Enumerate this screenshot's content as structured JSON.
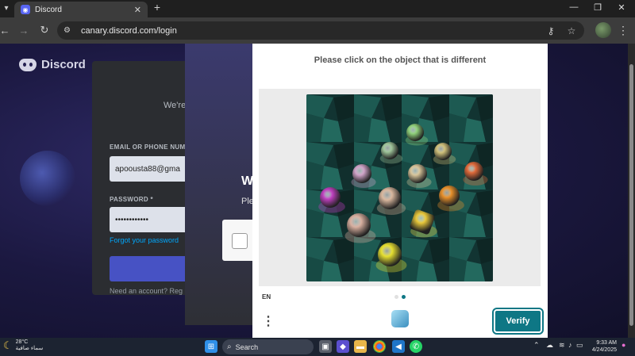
{
  "browser": {
    "tab_title": "Discord",
    "tab_close": "✕",
    "new_tab": "+",
    "url": "canary.discord.com/login",
    "window_controls": [
      "—",
      "❐",
      "✕"
    ]
  },
  "page": {
    "brand": "Discord",
    "login": {
      "subtitle": "We're",
      "email_label": "EMAIL OR PHONE NUM",
      "email_value": "apoousta88@gma",
      "password_label": "PASSWORD *",
      "password_value": "••••••••••••",
      "forgot": "Forgot your password",
      "need_account": "Need an account? Reg"
    },
    "overlay": {
      "heading_fragment": "W",
      "text_fragment": "Ple"
    }
  },
  "captcha": {
    "prompt": "Please click on the object that is different",
    "language": "EN",
    "verify_label": "Verify",
    "menu_glyph": "⋮",
    "accent_color": "#0e7785",
    "orbs": [
      {
        "color": "#8fd07a",
        "kind": "sphere"
      },
      {
        "color": "#9fc59a",
        "kind": "sphere"
      },
      {
        "color": "#cfc07a",
        "kind": "sphere"
      },
      {
        "color": "#cfa3c8",
        "kind": "sphere"
      },
      {
        "color": "#d8c59a",
        "kind": "sphere"
      },
      {
        "color": "#e06a3a",
        "kind": "sphere"
      },
      {
        "color": "#c040c0",
        "kind": "sphere"
      },
      {
        "color": "#d9b79e",
        "kind": "sphere"
      },
      {
        "color": "#e8902a",
        "kind": "sphere"
      },
      {
        "color": "#d9b0a0",
        "kind": "sphere"
      },
      {
        "color": "#e8c83a",
        "kind": "cube"
      },
      {
        "color": "#e6e030",
        "kind": "sphere"
      }
    ]
  },
  "taskbar": {
    "weather_temp": "28°C",
    "weather_desc": "سماء صافية",
    "search_placeholder": "Search",
    "time": "9:33 AM",
    "date": "4/24/2025"
  }
}
